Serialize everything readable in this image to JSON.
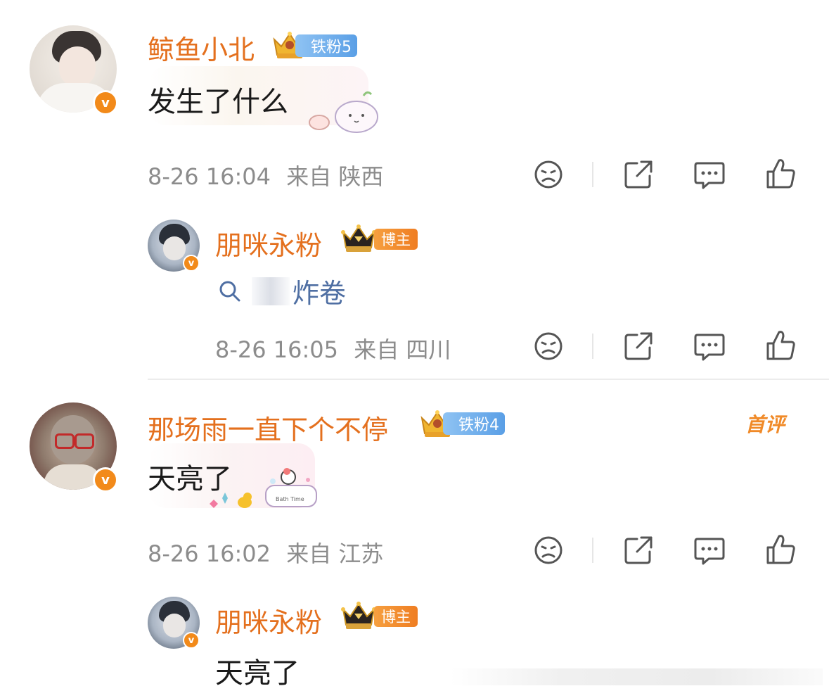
{
  "comments": [
    {
      "username": "鲸鱼小北",
      "fan_badge": "铁粉5",
      "text": "发生了什么",
      "time": "8-26 16:04",
      "location": "来自 陕西",
      "reply": {
        "username": "朋咪永粉",
        "owner_badge": "博主",
        "search_text": "炸卷",
        "time": "8-26 16:05",
        "location": "来自 四川"
      }
    },
    {
      "username": "那场雨一直下个不停",
      "fan_badge": "铁粉4",
      "first_label": "首评",
      "text": "天亮了",
      "time": "8-26 16:02",
      "location": "来自 江苏",
      "reply": {
        "username": "朋咪永粉",
        "owner_badge": "博主",
        "text": "天亮了"
      }
    }
  ],
  "icons": [
    "dislike-icon",
    "share-icon",
    "comment-icon",
    "like-icon",
    "verified-v-icon",
    "crown-icon",
    "search-icon"
  ],
  "colors": {
    "username": "#e4701e",
    "meta": "#8c8c8c",
    "fan_badge": "#6aaaf0",
    "owner_badge": "#f28a2a",
    "verified": "#f28a1a",
    "link": "#4f6fa3"
  }
}
